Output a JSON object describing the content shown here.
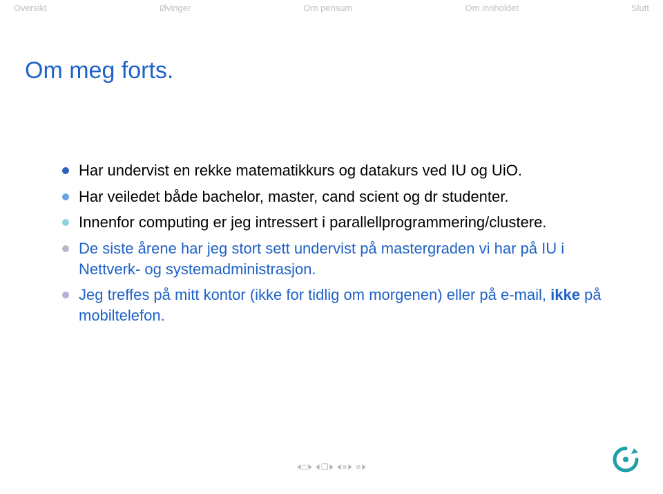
{
  "nav": {
    "items": [
      "Oversikt",
      "Øvinger",
      "Om pensum",
      "Om innholdet",
      "Slutt"
    ]
  },
  "title": "Om meg forts.",
  "bullets": [
    {
      "color": "b-blue",
      "text": "Har undervist en rekke matematikkurs og datakurs ved IU og UiO."
    },
    {
      "color": "b-ltblu",
      "text": "Har veiledet både bachelor, master, cand scient og dr studenter."
    },
    {
      "color": "b-teal",
      "text": "Innenfor computing er jeg intressert i parallellprogrammering/clustere."
    },
    {
      "color": "b-grey",
      "muted": true,
      "text": "De siste årene har jeg stort sett undervist på mastergraden vi har på IU i Nettverk- og systemadministrasjon."
    },
    {
      "color": "b-lil",
      "muted": true,
      "html": true,
      "parts": [
        "Jeg treffes på mitt kontor (ikke for tidlig om morgenen) eller på e-mail, ",
        "ikke",
        " på mobiltelefon."
      ]
    }
  ],
  "controls": {
    "slide_icon": "□",
    "copy_icon": "❐",
    "eq_icon": "≡",
    "refresh": "↻"
  }
}
